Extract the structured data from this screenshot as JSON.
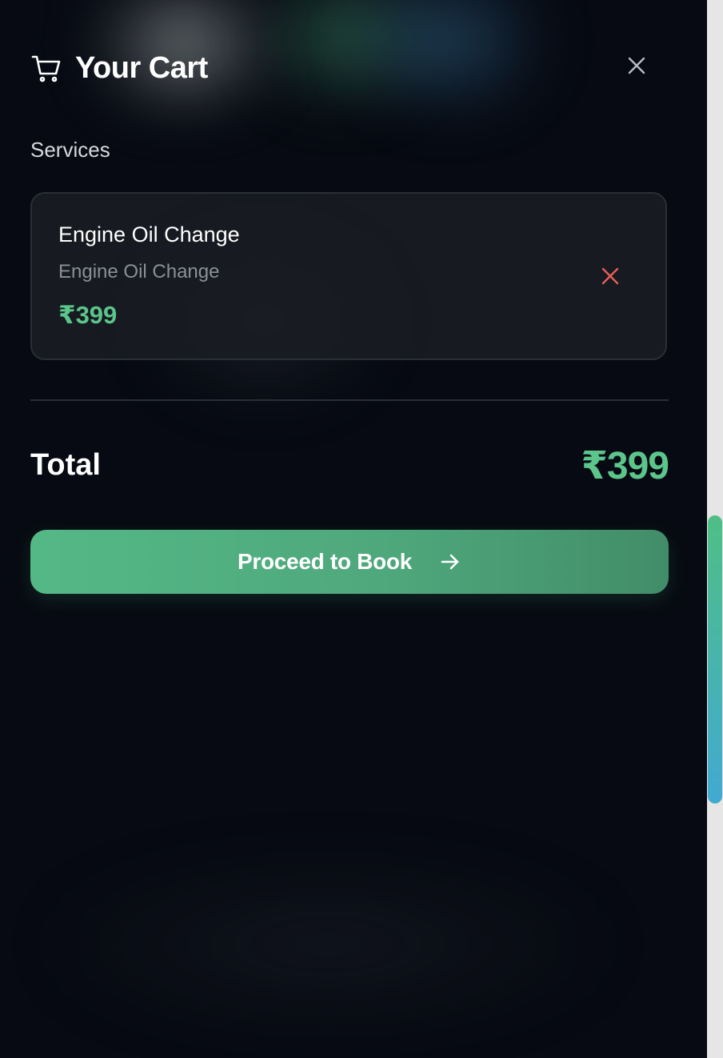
{
  "header": {
    "title": "Your Cart",
    "cart_icon": "cart-icon",
    "close_icon": "close-icon"
  },
  "services": {
    "label": "Services",
    "items": [
      {
        "name": "Engine Oil Change",
        "description": "Engine Oil Change",
        "price": "₹399",
        "remove_icon": "remove-icon"
      }
    ]
  },
  "summary": {
    "total_label": "Total",
    "total_value": "₹399"
  },
  "actions": {
    "proceed_label": "Proceed to Book",
    "proceed_icon": "arrow-right-icon"
  },
  "colors": {
    "accent_green": "#5cc58b",
    "remove_red": "#e5605a",
    "background": "#070a12",
    "card_border": "#2a2e36"
  }
}
